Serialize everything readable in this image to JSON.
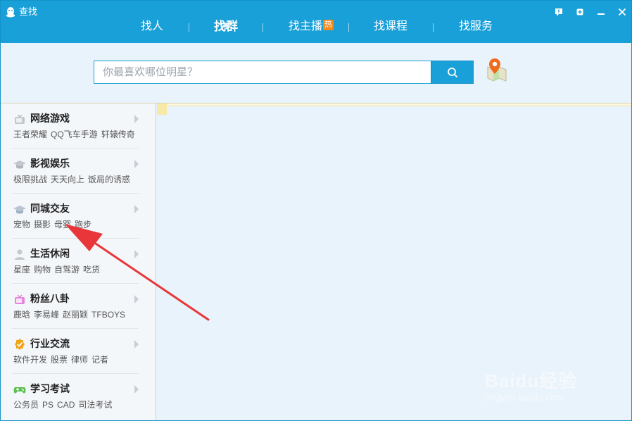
{
  "window": {
    "title": "查找"
  },
  "controls": {
    "feedback": "▮",
    "pin": "⊕",
    "minimize": "—",
    "close": "✕"
  },
  "tabs": [
    {
      "label": "找人",
      "active": false
    },
    {
      "label": "找群",
      "active": true
    },
    {
      "label": "找主播",
      "active": false,
      "badge": "热"
    },
    {
      "label": "找课程",
      "active": false
    },
    {
      "label": "找服务",
      "active": false
    }
  ],
  "search": {
    "value": "",
    "placeholder": "你最喜欢哪位明星？"
  },
  "categories": [
    {
      "title": "网络游戏",
      "icon": "tv-icon",
      "tags": [
        "王者荣耀",
        "QQ飞车手游",
        "轩辕传奇"
      ]
    },
    {
      "title": "影视娱乐",
      "icon": "graduation-cap-icon",
      "tags": [
        "极限挑战",
        "天天向上",
        "饭局的诱惑"
      ]
    },
    {
      "title": "同城交友",
      "icon": "graduation-cap-icon",
      "tags": [
        "宠物",
        "摄影",
        "母婴",
        "跑步"
      ]
    },
    {
      "title": "生活休闲",
      "icon": "person-icon",
      "tags": [
        "星座",
        "购物",
        "自驾游",
        "吃货"
      ]
    },
    {
      "title": "粉丝八卦",
      "icon": "tv-icon",
      "tags": [
        "鹿晗",
        "李易峰",
        "赵丽颖",
        "TFBOYS"
      ]
    },
    {
      "title": "行业交流",
      "icon": "verified-badge-icon",
      "tags": [
        "软件开发",
        "股票",
        "律师",
        "记者"
      ]
    },
    {
      "title": "学习考试",
      "icon": "gamepad-icon",
      "tags": [
        "公务员",
        "PS",
        "CAD",
        "司法考试"
      ]
    }
  ],
  "watermark": {
    "main": "Baidu经验",
    "sub": "jingyan.baidu.com"
  },
  "colors": {
    "brand": "#1aa0d9",
    "hot": "#f08a1c",
    "arrow": "#e8363a"
  }
}
